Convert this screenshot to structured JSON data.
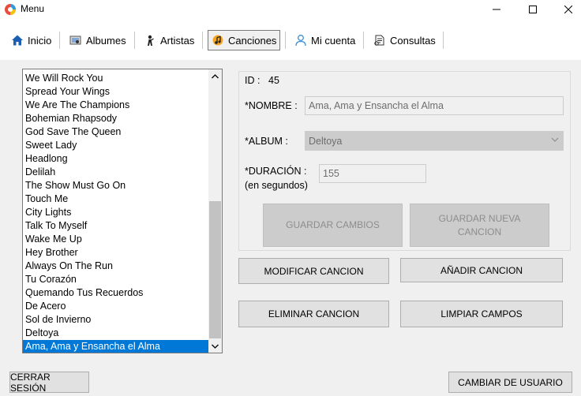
{
  "window": {
    "title": "Menu",
    "controls": {
      "minimize": "–",
      "maximize": "□",
      "close": "✕"
    }
  },
  "toolbar": {
    "items": [
      {
        "label": "Inicio",
        "icon": "home-icon"
      },
      {
        "label": "Albumes",
        "icon": "album-icon"
      },
      {
        "label": "Artistas",
        "icon": "artist-icon"
      },
      {
        "label": "Canciones",
        "icon": "music-icon",
        "active": true
      },
      {
        "label": "Mi cuenta",
        "icon": "user-icon"
      },
      {
        "label": "Consultas",
        "icon": "query-icon"
      }
    ]
  },
  "songs": {
    "items": [
      "We Will Rock You",
      "Spread Your Wings",
      "We Are The Champions",
      "Bohemian Rhapsody",
      "God Save The Queen",
      "Sweet Lady",
      "Headlong",
      "Delilah",
      "The Show Must Go On",
      "Touch Me",
      "City Lights",
      "Talk To Myself",
      "Wake Me Up",
      "Hey Brother",
      "Always On The Run",
      "Tu Corazón",
      "Quemando Tus Recuerdos",
      "De Acero",
      "Sol de Invierno",
      "Deltoya",
      "Ama, Ama y Ensancha el Alma"
    ],
    "selected_index": 20
  },
  "details": {
    "id_label": "ID :",
    "id_value": "45",
    "nombre_label": "*NOMBRE :",
    "nombre_value": "Ama, Ama y Ensancha el Alma",
    "album_label": "*ALBUM :",
    "album_value": "Deltoya",
    "duracion_label": "*DURACIÓN :",
    "duracion_sublabel": "(en segundos)",
    "duracion_value": "155",
    "guardar_cambios": "GUARDAR CAMBIOS",
    "guardar_nueva_line1": "GUARDAR NUEVA",
    "guardar_nueva_line2": "CANCION"
  },
  "actions": {
    "modificar": "MODIFICAR CANCION",
    "anadir": "AÑADIR CANCION",
    "eliminar": "ELIMINAR CANCION",
    "limpiar": "LIMPIAR CAMPOS"
  },
  "footer": {
    "cerrar_sesion": "CERRAR SESIÓN",
    "cambiar_usuario": "CAMBIAR DE USUARIO"
  },
  "colors": {
    "selection": "#0078d7",
    "home_icon": "#1a5fb4",
    "user_icon": "#3b8fd6"
  }
}
